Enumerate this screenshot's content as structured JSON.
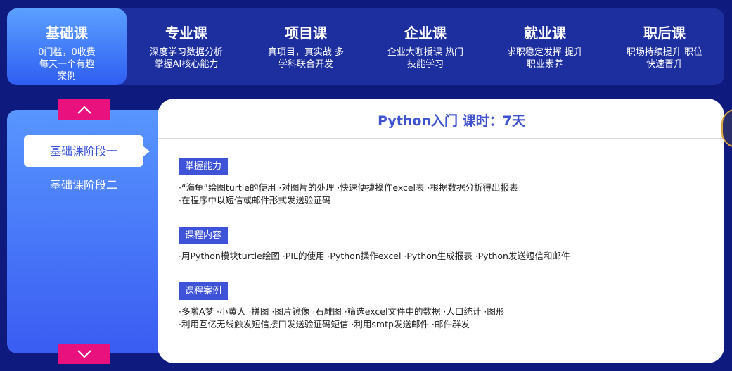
{
  "tabs": [
    {
      "title": "基础课",
      "desc": "0门槛，0收费 每天一个有趣案例"
    },
    {
      "title": "专业课",
      "desc": "深度学习数据分析 掌握AI核心能力"
    },
    {
      "title": "项目课",
      "desc": "真项目，真实战 多学科联合开发"
    },
    {
      "title": "企业课",
      "desc": "企业大咖授课 热门技能学习"
    },
    {
      "title": "就业课",
      "desc": "求职稳定发挥 提升职业素养"
    },
    {
      "title": "职后课",
      "desc": "职场持续提升 职位快速晋升"
    }
  ],
  "stages": [
    "基础课阶段一",
    "基础课阶段二"
  ],
  "card": {
    "title": "Python入门    课时：7天",
    "sections": [
      {
        "tag": "掌握能力",
        "line1": "·“海龟”绘图turtle的使用 ·对图片的处理 ·快速便捷操作excel表 ·根据数据分析得出报表",
        "line2": "·在程序中以短信或邮件形式发送验证码"
      },
      {
        "tag": "课程内容",
        "line1": "·用Python模块turtle绘图 ·PIL的使用 ·Python操作excel ·Python生成报表 ·Python发送短信和邮件",
        "line2": ""
      },
      {
        "tag": "课程案例",
        "line1": "·多啦A梦 ·小黄人 ·拼图 ·图片镜像 ·石雕图 ·筛选excel文件中的数据 ·人口统计 ·图形",
        "line2": "·利用互亿无线触发短信接口发送验证码短信 ·利用smtp发送邮件 ·邮件群发"
      }
    ]
  },
  "icons": {
    "up": "chevron-up-icon",
    "down": "chevron-down-icon"
  },
  "colors": {
    "accent": "#e8117d",
    "primary": "#3e53d8",
    "background": "#0f1a7e"
  }
}
